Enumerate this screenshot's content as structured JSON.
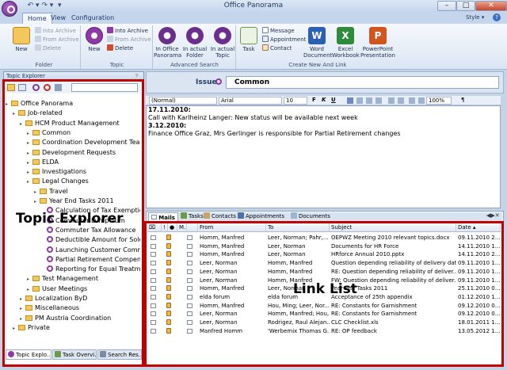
{
  "window": {
    "title": "Office Panorama",
    "tab_hint": "Style",
    "help": "?"
  },
  "ribbon_tabs": [
    "Home",
    "View",
    "Configuration"
  ],
  "groups": {
    "folder": {
      "label": "Folder",
      "new": "New",
      "into_archive": "Into Archive",
      "from_archive": "From Archive",
      "delete": "Delete"
    },
    "topic": {
      "label": "Topic",
      "new": "New",
      "into_archive": "Into Archive",
      "from_archive": "From Archive",
      "delete": "Delete"
    },
    "advanced_search": {
      "label": "Advanced Search",
      "b1": "In Office Panorama",
      "b2": "In actual Folder",
      "b3": "In actual Topic"
    },
    "create": {
      "label": "Create New And Link",
      "task": "Task",
      "message": "Message",
      "appointment": "Appointment",
      "contact": "Contact",
      "word": "Word Document",
      "excel": "Excel Workbook",
      "ppt": "PowerPoint Presentation"
    }
  },
  "topic_explorer": {
    "title": "Topic Explorer",
    "overlay": "Topic Explorer",
    "items": [
      {
        "label": "Office Panorama",
        "indent": 0
      },
      {
        "label": "Job-related",
        "indent": 1
      },
      {
        "label": "HCM Product Management",
        "indent": 2
      },
      {
        "label": "Common",
        "indent": 3
      },
      {
        "label": "Coordination Development Team",
        "indent": 3
      },
      {
        "label": "Development Requests",
        "indent": 3
      },
      {
        "label": "ELDA",
        "indent": 3
      },
      {
        "label": "Investigations",
        "indent": 3
      },
      {
        "label": "Legal Changes",
        "indent": 3
      },
      {
        "label": "Travel",
        "indent": 4
      },
      {
        "label": "Year End Tasks 2011",
        "indent": 4
      },
      {
        "label": "Calculation of Tax Exemption",
        "indent": 5
      },
      {
        "label": "Commuter Lump Sum",
        "indent": 5
      },
      {
        "label": "Commuter Tax Allowance",
        "indent": 5
      },
      {
        "label": "Deductible Amount for Sole Earner",
        "indent": 5
      },
      {
        "label": "Launching Customer Communication",
        "indent": 5
      },
      {
        "label": "Partial Retirement Compensation",
        "indent": 5
      },
      {
        "label": "Reporting for Equal Treatment",
        "indent": 5
      },
      {
        "label": "Test Management",
        "indent": 3
      },
      {
        "label": "User Meetings",
        "indent": 3
      },
      {
        "label": "Localization ByD",
        "indent": 2
      },
      {
        "label": "Miscellaneous",
        "indent": 2
      },
      {
        "label": "PM Austria Coordination",
        "indent": 2
      },
      {
        "label": "Private",
        "indent": 1
      }
    ],
    "bottom_tabs": [
      "Topic Explo...",
      "Task Overvi...",
      "Search Res..."
    ]
  },
  "issue": {
    "label": "Issue",
    "value": "Common"
  },
  "format_bar": {
    "style": "(Normal)",
    "font": "Arial",
    "size": "10",
    "zoom": "100%"
  },
  "editor": {
    "lines": [
      {
        "text": "17.11.2010:",
        "bold": true
      },
      {
        "text": "Call with Karlheinz Langer: New status will be available next week",
        "bold": false
      },
      {
        "text": "3.12.2010:",
        "bold": true
      },
      {
        "text": "Finance Office Graz, Mrs Gerlinger is responsible for Partial Retirement changes",
        "bold": false
      }
    ]
  },
  "link_list": {
    "overlay": "Link List",
    "tabs": [
      "Mails",
      "Tasks",
      "Contacts",
      "Appointments",
      "Documents"
    ],
    "columns": [
      "!",
      "M..",
      "From",
      "To",
      "Subject",
      "Date"
    ],
    "rows": [
      {
        "from": "Homm, Manfred",
        "to": "Leer, Norman; Pahr,...",
        "subject": "OEPWZ Meeting 2010 relevant topics.docx",
        "date": "09.11.2010 2..."
      },
      {
        "from": "Homm, Manfred",
        "to": "Leer, Norman",
        "subject": "Documents for HR Force",
        "date": "14.11.2010 1..."
      },
      {
        "from": "Homm, Manfred",
        "to": "Leer, Norman",
        "subject": "HRforce Annual 2010.pptx",
        "date": "14.11.2010 2..."
      },
      {
        "from": "Leer, Norman",
        "to": "Homm, Manfred",
        "subject": "Question depending reliability of delivery date",
        "date": "09.11.2010 1..."
      },
      {
        "from": "Leer, Norman",
        "to": "Homm, Manfred",
        "subject": "RE: Question depending reliability of deliver...",
        "date": "09.11.2010 1..."
      },
      {
        "from": "Leer, Norman",
        "to": "Homm, Manfred",
        "subject": "FW: Question depending reliability of deliver...",
        "date": "09.11.2010 1..."
      },
      {
        "from": "Homm, Manfred",
        "to": "Leer, Norman",
        "subject": "Year End Tasks 2011",
        "date": "25.11.2010 0..."
      },
      {
        "from": "elda forum",
        "to": "elda forum",
        "subject": "Acceptance of 25th appendix",
        "date": "01.12.2010 1..."
      },
      {
        "from": "Homm, Manfred",
        "to": "Hou, Ming; Leer, Nor...",
        "subject": "RE: Constants for Garnishment",
        "date": "09.12.2010 0..."
      },
      {
        "from": "Leer, Norman",
        "to": "Homm, Manfred; Hou,...",
        "subject": "RE: Constants for Garnishment",
        "date": "09.12.2010 0..."
      },
      {
        "from": "Leer, Norman",
        "to": "Rodrigez, Raul Alejan...",
        "subject": "CLC Checklist.xls",
        "date": "18.01.2011 1..."
      },
      {
        "from": "Manfred Homm",
        "to": "'Werbemix Thomas G...",
        "subject": "RE: OP feedback",
        "date": "13.05.2012 1..."
      }
    ]
  },
  "colors": {
    "highlight_border": "#c00000",
    "accent": "#6a2f8c"
  }
}
